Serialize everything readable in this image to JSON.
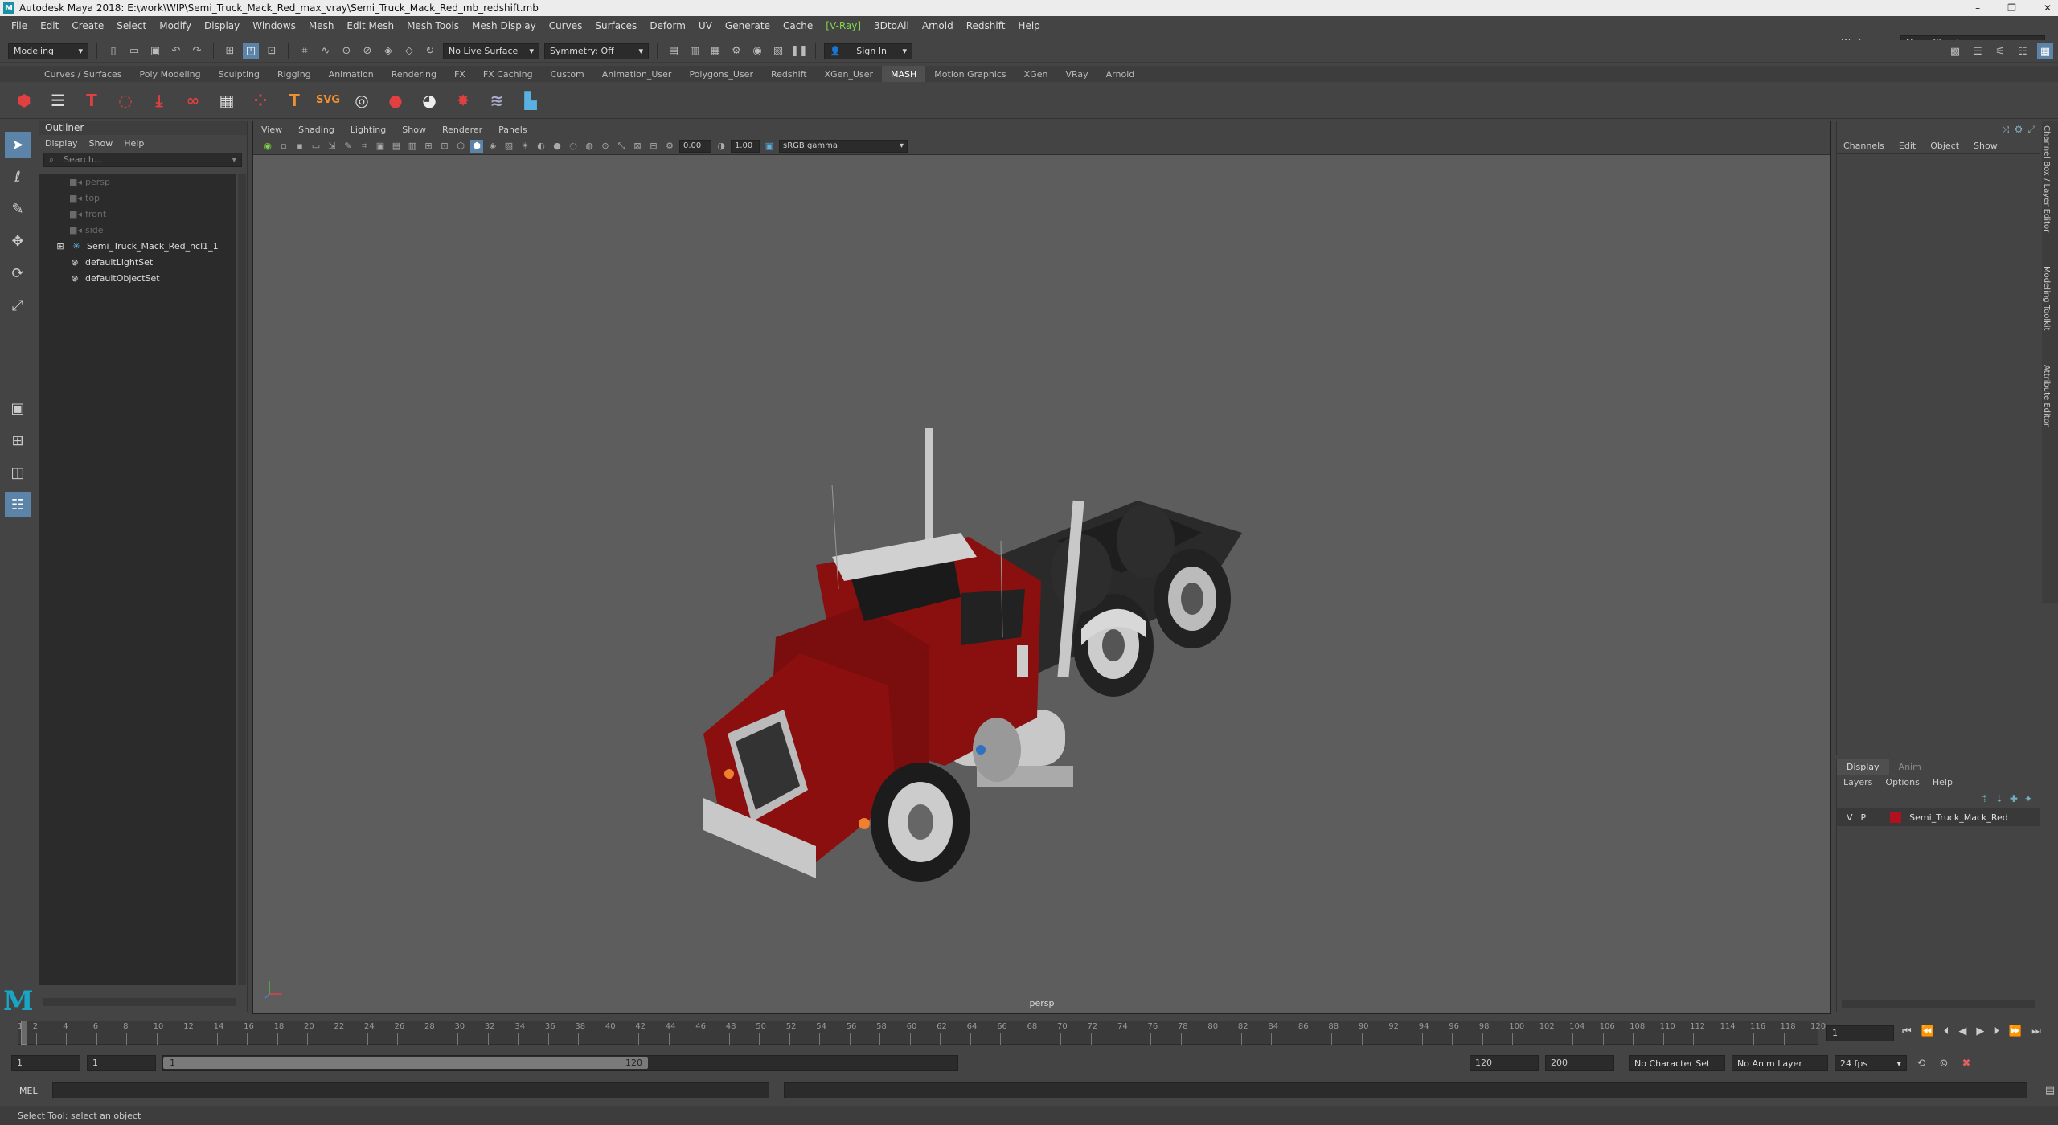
{
  "window": {
    "title": "Autodesk Maya 2018: E:\\work\\WIP\\Semi_Truck_Mack_Red_max_vray\\Semi_Truck_Mack_Red_mb_redshift.mb",
    "minimize": "–",
    "restore": "❐",
    "close": "✕"
  },
  "menubar": {
    "items": [
      "File",
      "Edit",
      "Create",
      "Select",
      "Modify",
      "Display",
      "Windows",
      "Mesh",
      "Edit Mesh",
      "Mesh Tools",
      "Mesh Display",
      "Curves",
      "Surfaces",
      "Deform",
      "UV",
      "Generate",
      "Cache"
    ],
    "vray": "V-Ray",
    "items2": [
      "3DtoAll",
      "Arnold",
      "Redshift",
      "Help"
    ]
  },
  "workspace": {
    "label": "Workspace :",
    "value": "Maya Classic"
  },
  "statusline": {
    "mode": "Modeling",
    "live_surface": "No Live Surface",
    "symmetry": "Symmetry: Off",
    "sign_in": "Sign In"
  },
  "shelf_tabs": [
    "Curves / Surfaces",
    "Poly Modeling",
    "Sculpting",
    "Rigging",
    "Animation",
    "Rendering",
    "FX",
    "FX Caching",
    "Custom",
    "Animation_User",
    "Polygons_User",
    "Redshift",
    "XGen_User",
    "MASH",
    "Motion Graphics",
    "XGen",
    "VRay",
    "Arnold"
  ],
  "shelf_active": "MASH",
  "outliner": {
    "title": "Outliner",
    "menu": [
      "Display",
      "Show",
      "Help"
    ],
    "search_placeholder": "Search...",
    "items": [
      {
        "label": "persp",
        "dim": true
      },
      {
        "label": "top",
        "dim": true
      },
      {
        "label": "front",
        "dim": true
      },
      {
        "label": "side",
        "dim": true
      },
      {
        "label": "Semi_Truck_Mack_Red_ncl1_1",
        "dim": false
      },
      {
        "label": "defaultLightSet",
        "dim": false
      },
      {
        "label": "defaultObjectSet",
        "dim": false
      }
    ]
  },
  "viewport": {
    "menu": [
      "View",
      "Shading",
      "Lighting",
      "Show",
      "Renderer",
      "Panels"
    ],
    "exposure": "0.00",
    "gamma": "1.00",
    "color_space": "sRGB gamma",
    "camera": "persp"
  },
  "channelbox": {
    "menu": [
      "Channels",
      "Edit",
      "Object",
      "Show"
    ]
  },
  "layers": {
    "tabs": [
      "Display",
      "Anim"
    ],
    "menu": [
      "Layers",
      "Options",
      "Help"
    ],
    "row": {
      "v": "V",
      "p": "P",
      "name": "Semi_Truck_Mack_Red",
      "color": "#b01020"
    }
  },
  "side_tabs": [
    "Channel Box / Layer Editor",
    "Modeling Toolkit",
    "Attribute Editor"
  ],
  "timeslider": {
    "ticks": [
      "1",
      "2",
      "4",
      "6",
      "8",
      "10",
      "12",
      "14",
      "16",
      "18",
      "20",
      "22",
      "24",
      "26",
      "28",
      "30",
      "32",
      "34",
      "36",
      "38",
      "40",
      "42",
      "44",
      "46",
      "48",
      "50",
      "52",
      "54",
      "56",
      "58",
      "60",
      "62",
      "64",
      "66",
      "68",
      "70",
      "72",
      "74",
      "76",
      "78",
      "80",
      "82",
      "84",
      "86",
      "88",
      "90",
      "92",
      "94",
      "96",
      "98",
      "100",
      "102",
      "104",
      "106",
      "108",
      "110",
      "112",
      "114",
      "116",
      "118",
      "120"
    ],
    "current_frame": "1"
  },
  "range": {
    "start": "1",
    "anim_start": "1",
    "slider_start": "1",
    "slider_end": "120",
    "end": "120",
    "anim_end": "200",
    "character_set": "No Character Set",
    "anim_layer": "No Anim Layer",
    "fps": "24 fps"
  },
  "cmdline": {
    "lang": "MEL"
  },
  "helpline": {
    "text": "Select Tool: select an object"
  }
}
